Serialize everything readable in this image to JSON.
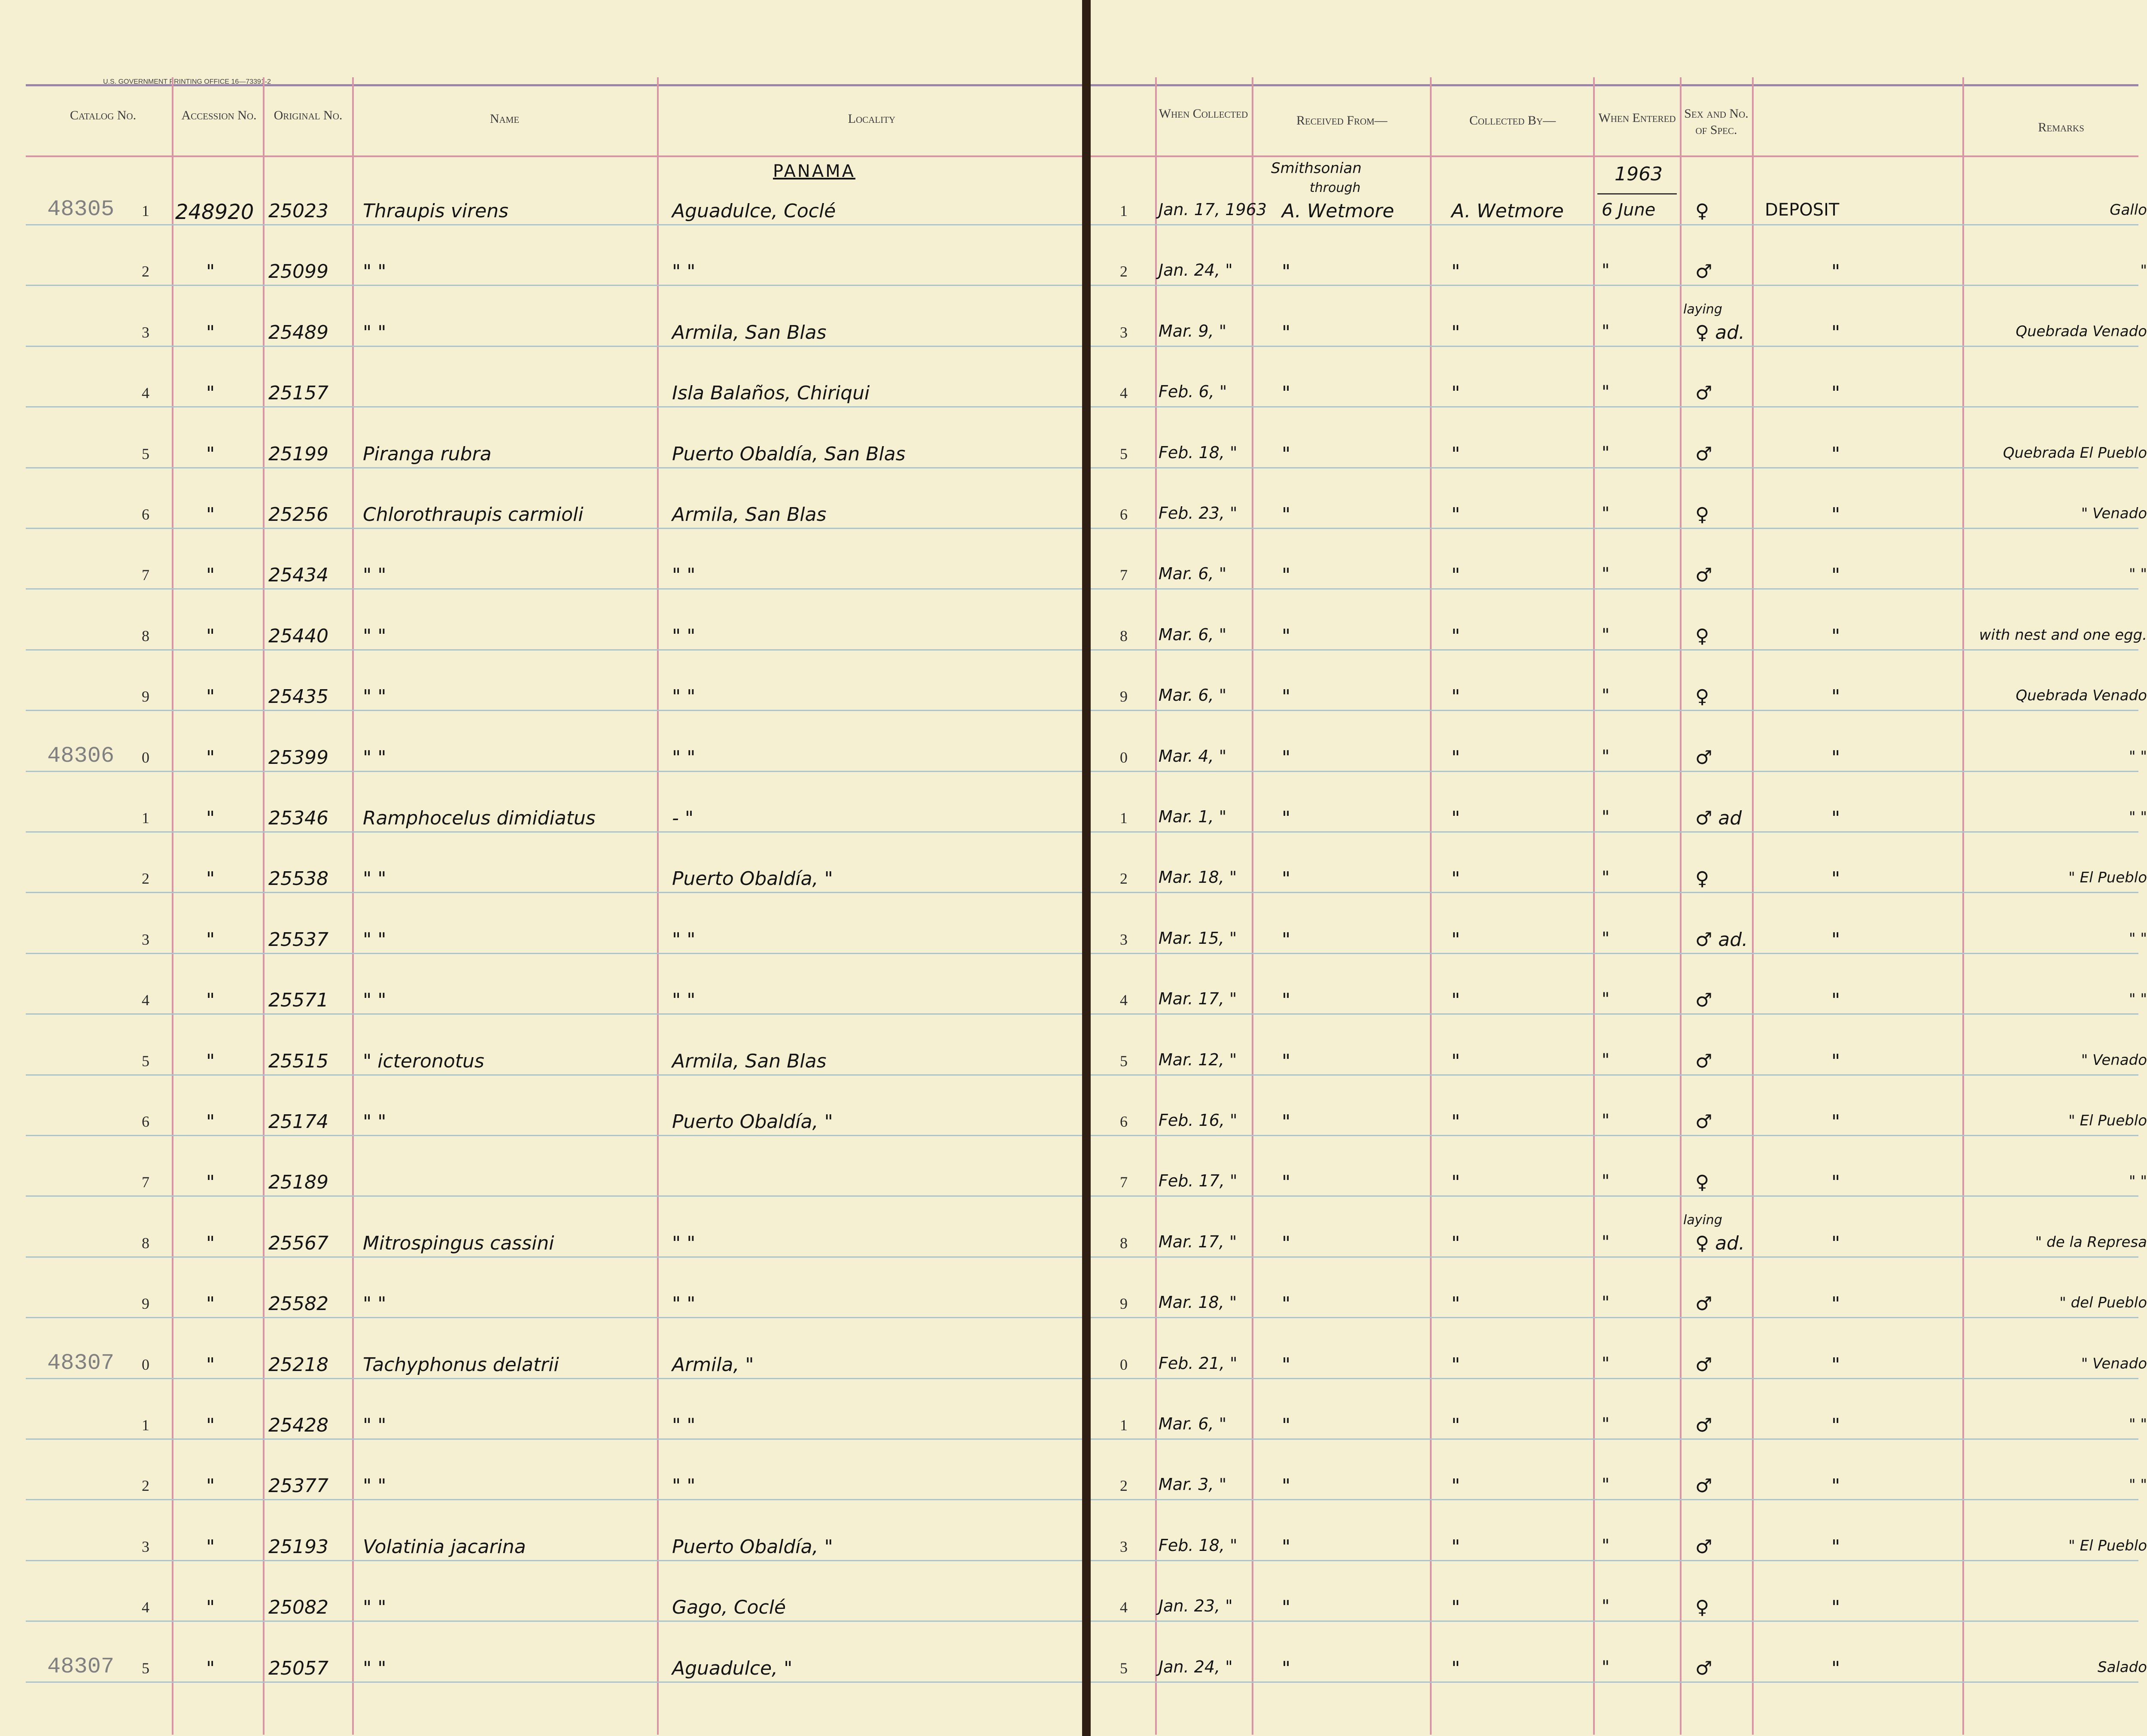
{
  "document": {
    "gpo_line": "U.S. GOVERNMENT PRINTING OFFICE   16—73391-2",
    "columns_left": {
      "catalog": "Catalog No.",
      "accession": "Accession No.",
      "original": "Original No.",
      "name": "Name",
      "locality": "Locality"
    },
    "columns_right": {
      "when_collected": "When Collected",
      "received_from": "Received From—",
      "collected_by": "Collected By—",
      "when_entered": "When Entered",
      "sex": "Sex and No. of Spec.",
      "remarks": "Remarks"
    },
    "header_notes": {
      "country": "PANAMA",
      "received_line1": "Smithsonian",
      "received_line2": "through",
      "year": "1963"
    },
    "rows": [
      {
        "stamp": "48305",
        "digit": "1",
        "acc": "248920",
        "orig": "25023",
        "name": "Thraupis virens",
        "loc": "Aguadulce, Coclé",
        "rdigit": "1",
        "date": "Jan. 17, 1963",
        "recv": "A. Wetmore",
        "coll": "A. Wetmore",
        "entered": "6 June",
        "note": "",
        "sex": "♀",
        "deposit": "DEPOSIT",
        "remark": "Gallo"
      },
      {
        "stamp": "",
        "digit": "2",
        "acc": "\"",
        "orig": "25099",
        "name": "\"     \"",
        "loc": "\"     \"",
        "rdigit": "2",
        "date": "Jan. 24, \"",
        "recv": "\"",
        "coll": "\"",
        "entered": "\"",
        "note": "",
        "sex": "♂",
        "deposit": "\"",
        "remark": "\""
      },
      {
        "stamp": "",
        "digit": "3",
        "acc": "\"",
        "orig": "25489",
        "name": "\"     \"",
        "loc": "Armila, San Blas",
        "rdigit": "3",
        "date": "Mar. 9, \"",
        "recv": "\"",
        "coll": "\"",
        "entered": "\"",
        "note": "laying",
        "sex": "♀ ad.",
        "deposit": "\"",
        "remark": "Quebrada Venado"
      },
      {
        "stamp": "",
        "digit": "4",
        "acc": "\"",
        "orig": "25157",
        "name": "",
        "loc": "Isla Balaños, Chiriqui",
        "rdigit": "4",
        "date": "Feb. 6, \"",
        "recv": "\"",
        "coll": "\"",
        "entered": "\"",
        "note": "",
        "sex": "♂",
        "deposit": "\"",
        "remark": ""
      },
      {
        "stamp": "",
        "digit": "5",
        "acc": "\"",
        "orig": "25199",
        "name": "Piranga rubra",
        "loc": "Puerto Obaldía, San Blas",
        "rdigit": "5",
        "date": "Feb. 18, \"",
        "recv": "\"",
        "coll": "\"",
        "entered": "\"",
        "note": "",
        "sex": "♂",
        "deposit": "\"",
        "remark": "Quebrada El Pueblo"
      },
      {
        "stamp": "",
        "digit": "6",
        "acc": "\"",
        "orig": "25256",
        "name": "Chlorothraupis carmioli",
        "loc": "Armila, San Blas",
        "rdigit": "6",
        "date": "Feb. 23, \"",
        "recv": "\"",
        "coll": "\"",
        "entered": "\"",
        "note": "",
        "sex": "♀",
        "deposit": "\"",
        "remark": "\"   Venado"
      },
      {
        "stamp": "",
        "digit": "7",
        "acc": "\"",
        "orig": "25434",
        "name": "\"     \"",
        "loc": "\"     \"",
        "rdigit": "7",
        "date": "Mar. 6, \"",
        "recv": "\"",
        "coll": "\"",
        "entered": "\"",
        "note": "",
        "sex": "♂",
        "deposit": "\"",
        "remark": "\"     \""
      },
      {
        "stamp": "",
        "digit": "8",
        "acc": "\"",
        "orig": "25440",
        "name": "\"     \"",
        "loc": "\"     \"",
        "rdigit": "8",
        "date": "Mar. 6, \"",
        "recv": "\"",
        "coll": "\"",
        "entered": "\"",
        "note": "",
        "sex": "♀",
        "deposit": "\"",
        "remark": "with nest and one egg."
      },
      {
        "stamp": "",
        "digit": "9",
        "acc": "\"",
        "orig": "25435",
        "name": "\"     \"",
        "loc": "\"     \"",
        "rdigit": "9",
        "date": "Mar. 6, \"",
        "recv": "\"",
        "coll": "\"",
        "entered": "\"",
        "note": "",
        "sex": "♀",
        "deposit": "\"",
        "remark": "Quebrada Venado"
      },
      {
        "stamp": "48306",
        "digit": "0",
        "acc": "\"",
        "orig": "25399",
        "name": "\"     \"",
        "loc": "\"     \"",
        "rdigit": "0",
        "date": "Mar. 4, \"",
        "recv": "\"",
        "coll": "\"",
        "entered": "\"",
        "note": "",
        "sex": "♂",
        "deposit": "\"",
        "remark": "\"     \""
      },
      {
        "stamp": "",
        "digit": "1",
        "acc": "\"",
        "orig": "25346",
        "name": "Ramphocelus dimidiatus",
        "loc": "-     \"",
        "rdigit": "1",
        "date": "Mar. 1, \"",
        "recv": "\"",
        "coll": "\"",
        "entered": "\"",
        "note": "",
        "sex": "♂ ad",
        "deposit": "\"",
        "remark": "\"     \""
      },
      {
        "stamp": "",
        "digit": "2",
        "acc": "\"",
        "orig": "25538",
        "name": "\"     \"",
        "loc": "Puerto Obaldía, \"",
        "rdigit": "2",
        "date": "Mar. 18, \"",
        "recv": "\"",
        "coll": "\"",
        "entered": "\"",
        "note": "",
        "sex": "♀",
        "deposit": "\"",
        "remark": "\"  El Pueblo"
      },
      {
        "stamp": "",
        "digit": "3",
        "acc": "\"",
        "orig": "25537",
        "name": "\"     \"",
        "loc": "\"     \"",
        "rdigit": "3",
        "date": "Mar. 15, \"",
        "recv": "\"",
        "coll": "\"",
        "entered": "\"",
        "note": "",
        "sex": "♂ ad.",
        "deposit": "\"",
        "remark": "\"     \""
      },
      {
        "stamp": "",
        "digit": "4",
        "acc": "\"",
        "orig": "25571",
        "name": "\"     \"",
        "loc": "\"     \"",
        "rdigit": "4",
        "date": "Mar. 17, \"",
        "recv": "\"",
        "coll": "\"",
        "entered": "\"",
        "note": "",
        "sex": "♂",
        "deposit": "\"",
        "remark": "\"     \""
      },
      {
        "stamp": "",
        "digit": "5",
        "acc": "\"",
        "orig": "25515",
        "name": "\"   icteronotus",
        "loc": "Armila, San Blas",
        "rdigit": "5",
        "date": "Mar. 12, \"",
        "recv": "\"",
        "coll": "\"",
        "entered": "\"",
        "note": "",
        "sex": "♂",
        "deposit": "\"",
        "remark": "\"   Venado"
      },
      {
        "stamp": "",
        "digit": "6",
        "acc": "\"",
        "orig": "25174",
        "name": "\"     \"",
        "loc": "Puerto Obaldía, \"",
        "rdigit": "6",
        "date": "Feb. 16, \"",
        "recv": "\"",
        "coll": "\"",
        "entered": "\"",
        "note": "",
        "sex": "♂",
        "deposit": "\"",
        "remark": "\"  El Pueblo"
      },
      {
        "stamp": "",
        "digit": "7",
        "acc": "\"",
        "orig": "25189",
        "name": "",
        "loc": "",
        "rdigit": "7",
        "date": "Feb. 17, \"",
        "recv": "\"",
        "coll": "\"",
        "entered": "\"",
        "note": "",
        "sex": "♀",
        "deposit": "\"",
        "remark": "\"     \""
      },
      {
        "stamp": "",
        "digit": "8",
        "acc": "\"",
        "orig": "25567",
        "name": "Mitrospingus cassini",
        "loc": "\"     \"",
        "rdigit": "8",
        "date": "Mar. 17, \"",
        "recv": "\"",
        "coll": "\"",
        "entered": "\"",
        "note": "laying",
        "sex": "♀ ad.",
        "deposit": "\"",
        "remark": "\" de la Represa"
      },
      {
        "stamp": "",
        "digit": "9",
        "acc": "\"",
        "orig": "25582",
        "name": "\"     \"",
        "loc": "\"     \"",
        "rdigit": "9",
        "date": "Mar. 18, \"",
        "recv": "\"",
        "coll": "\"",
        "entered": "\"",
        "note": "",
        "sex": "♂",
        "deposit": "\"",
        "remark": "\"  del Pueblo"
      },
      {
        "stamp": "48307",
        "digit": "0",
        "acc": "\"",
        "orig": "25218",
        "name": "Tachyphonus delatrii",
        "loc": "Armila, \"",
        "rdigit": "0",
        "date": "Feb. 21, \"",
        "recv": "\"",
        "coll": "\"",
        "entered": "\"",
        "note": "",
        "sex": "♂",
        "deposit": "\"",
        "remark": "\"   Venado"
      },
      {
        "stamp": "",
        "digit": "1",
        "acc": "\"",
        "orig": "25428",
        "name": "\"     \"",
        "loc": "\"     \"",
        "rdigit": "1",
        "date": "Mar. 6, \"",
        "recv": "\"",
        "coll": "\"",
        "entered": "\"",
        "note": "",
        "sex": "♂",
        "deposit": "\"",
        "remark": "\"     \""
      },
      {
        "stamp": "",
        "digit": "2",
        "acc": "\"",
        "orig": "25377",
        "name": "\"     \"",
        "loc": "\"     \"",
        "rdigit": "2",
        "date": "Mar. 3, \"",
        "recv": "\"",
        "coll": "\"",
        "entered": "\"",
        "note": "",
        "sex": "♂",
        "deposit": "\"",
        "remark": "\"     \""
      },
      {
        "stamp": "",
        "digit": "3",
        "acc": "\"",
        "orig": "25193",
        "name": "Volatinia jacarina",
        "loc": "Puerto Obaldía, \"",
        "rdigit": "3",
        "date": "Feb. 18, \"",
        "recv": "\"",
        "coll": "\"",
        "entered": "\"",
        "note": "",
        "sex": "♂",
        "deposit": "\"",
        "remark": "\"  El Pueblo"
      },
      {
        "stamp": "",
        "digit": "4",
        "acc": "\"",
        "orig": "25082",
        "name": "\"     \"",
        "loc": "Gago, Coclé",
        "rdigit": "4",
        "date": "Jan. 23, \"",
        "recv": "\"",
        "coll": "\"",
        "entered": "\"",
        "note": "",
        "sex": "♀",
        "deposit": "\"",
        "remark": ""
      },
      {
        "stamp": "48307",
        "digit": "5",
        "acc": "\"",
        "orig": "25057",
        "name": "\"     \"",
        "loc": "Aguadulce, \"",
        "rdigit": "5",
        "date": "Jan. 24, \"",
        "recv": "\"",
        "coll": "\"",
        "entered": "\"",
        "note": "",
        "sex": "♂",
        "deposit": "\"",
        "remark": "Salado"
      }
    ]
  }
}
